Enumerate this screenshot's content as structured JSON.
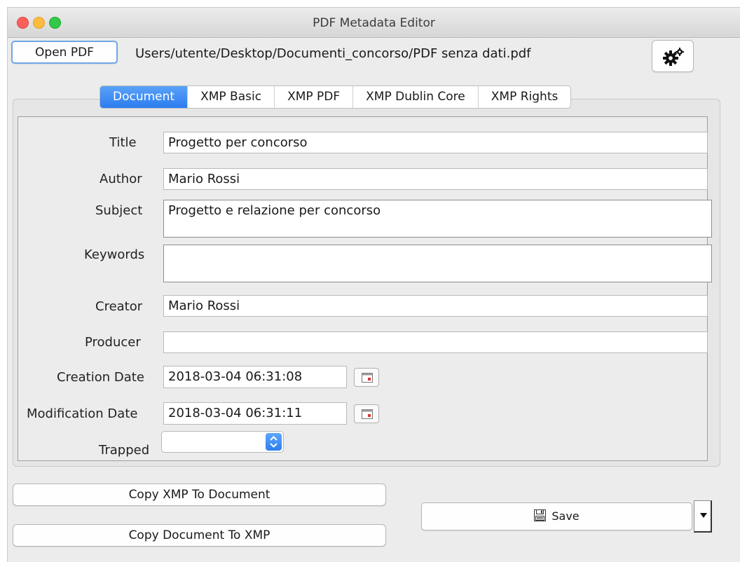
{
  "window": {
    "title": "PDF Metadata Editor"
  },
  "toolbar": {
    "open_label": "Open PDF",
    "file_path": "Users/utente/Desktop/Documenti_concorso/PDF senza dati.pdf",
    "settings_icon": "gears-icon"
  },
  "tabs": [
    {
      "label": "Document",
      "active": true
    },
    {
      "label": "XMP Basic",
      "active": false
    },
    {
      "label": "XMP PDF",
      "active": false
    },
    {
      "label": "XMP Dublin Core",
      "active": false
    },
    {
      "label": "XMP Rights",
      "active": false
    }
  ],
  "form": {
    "title_label": "Title",
    "title_value": "Progetto per concorso",
    "author_label": "Author",
    "author_value": "Mario Rossi",
    "subject_label": "Subject",
    "subject_value": "Progetto e relazione per concorso",
    "keywords_label": "Keywords",
    "keywords_value": "",
    "creator_label": "Creator",
    "creator_value": "Mario Rossi",
    "producer_label": "Producer",
    "producer_value": "",
    "creation_label": "Creation Date",
    "creation_value": "2018-03-04 06:31:08",
    "modification_label": "Modification Date",
    "modification_value": "2018-03-04 06:31:11",
    "trapped_label": "Trapped",
    "trapped_value": ""
  },
  "actions": {
    "copy_xmp_to_doc": "Copy XMP To Document",
    "copy_doc_to_xmp": "Copy Document To XMP",
    "save": "Save"
  },
  "colors": {
    "accent": "#2c7cf0",
    "tab_active": "#4a94f6"
  }
}
